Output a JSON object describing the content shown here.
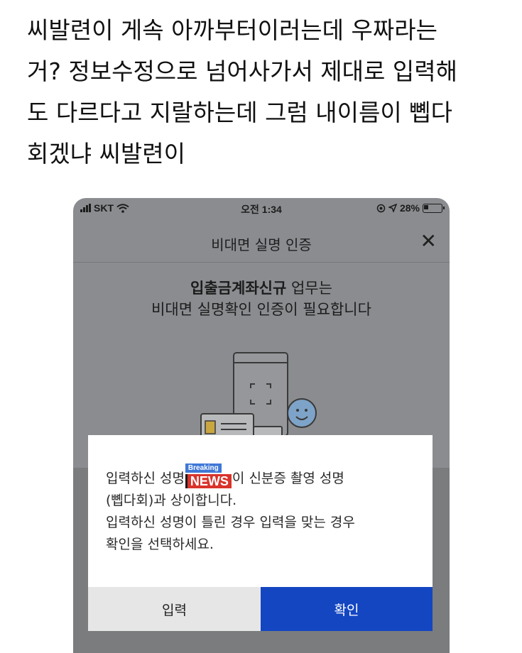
{
  "post": {
    "text": "씨발련이 게속 아까부터이러는데 우짜라는\n거? 정보수정으로 넘어사가서 제대로 입력해\n도 다르다고 지랄하는데 그럼 내이름이 뼵다\n회겠냐 씨발련이"
  },
  "status_bar": {
    "carrier": "SKT",
    "time": "오전 1:34",
    "battery": "28%",
    "signal_icon": "signal-bars-icon",
    "wifi_icon": "wifi-icon",
    "location_icon": "location-arrow-icon"
  },
  "header": {
    "title": "비대면 실명 인증",
    "close_label": "✕"
  },
  "headline": {
    "bold": "입출금계좌신규",
    "rest": " 업무는",
    "line2": "비대면 실명확인 인증이 필요합니다"
  },
  "dialog": {
    "msg_before_badge": "입력하신 성명",
    "badge_top": "Breaking",
    "badge_main": "NEWS",
    "msg_after_badge": "이 신분증 촬영 성명",
    "line2": "(뼵다회)과 상이합니다.",
    "line3": "입력하신 성명이 틀린 경우 입력을 맞는 경우",
    "line4": "확인을 선택하세요.",
    "btn_input": "입력",
    "btn_confirm": "확인"
  },
  "colors": {
    "confirm_button": "#1446c2",
    "input_button": "#e6e6e6",
    "overlay": "#8a8c8f"
  }
}
